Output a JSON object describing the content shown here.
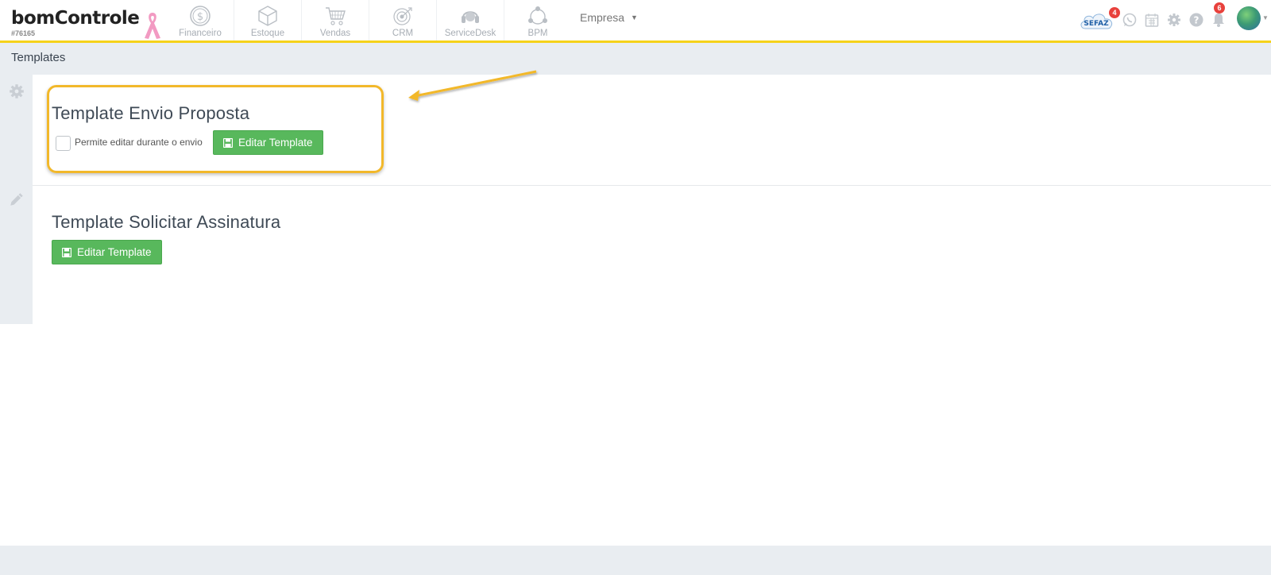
{
  "header": {
    "logo_text": "bomControle",
    "account_id": "#76165",
    "modules": [
      {
        "label": "Financeiro",
        "icon": "dollar-coin-icon"
      },
      {
        "label": "Estoque",
        "icon": "box-icon"
      },
      {
        "label": "Vendas",
        "icon": "shopping-cart-icon"
      },
      {
        "label": "CRM",
        "icon": "target-icon"
      },
      {
        "label": "ServiceDesk",
        "icon": "headset-icon"
      },
      {
        "label": "BPM",
        "icon": "network-icon"
      }
    ],
    "company_menu": "Empresa",
    "sefaz_label": "SEFAZ",
    "sefaz_badge": "4",
    "notifications_badge": "6"
  },
  "breadcrumb": "Templates",
  "templates": [
    {
      "title": "Template Envio Proposta",
      "checkbox_label": "Permite editar durante o envio",
      "button_label": "Editar Template"
    },
    {
      "title": "Template Solicitar Assinatura",
      "button_label": "Editar Template"
    }
  ],
  "colors": {
    "accent_yellow": "#f5d21a",
    "highlight": "#f2b82a",
    "button_green": "#58b85c",
    "badge_red": "#e8413c"
  }
}
